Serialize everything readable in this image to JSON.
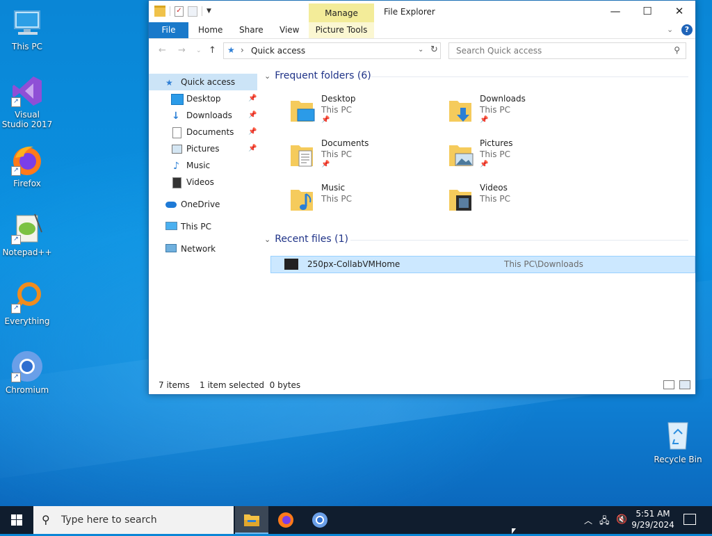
{
  "desktop": {
    "icons": [
      {
        "label": "This PC"
      },
      {
        "label": "Visual Studio 2017"
      },
      {
        "label": "Firefox"
      },
      {
        "label": "Notepad++"
      },
      {
        "label": "Everything"
      },
      {
        "label": "Chromium"
      },
      {
        "label": "Recycle Bin"
      }
    ]
  },
  "window": {
    "title": "File Explorer",
    "contextual_group": "Manage",
    "tabs": [
      "File",
      "Home",
      "Share",
      "View",
      "Picture Tools"
    ],
    "address": "Quick access",
    "search_placeholder": "Search Quick access",
    "help": "?"
  },
  "nav": {
    "items": [
      {
        "label": "Quick access",
        "icon": "star-icon",
        "selected": true
      },
      {
        "label": "Desktop",
        "icon": "desktop-icon",
        "pinned": true
      },
      {
        "label": "Downloads",
        "icon": "download-icon",
        "pinned": true
      },
      {
        "label": "Documents",
        "icon": "document-icon",
        "pinned": true
      },
      {
        "label": "Pictures",
        "icon": "picture-icon",
        "pinned": true
      },
      {
        "label": "Music",
        "icon": "music-icon"
      },
      {
        "label": "Videos",
        "icon": "video-icon"
      },
      {
        "label": "OneDrive",
        "icon": "cloud-icon"
      },
      {
        "label": "This PC",
        "icon": "computer-icon"
      },
      {
        "label": "Network",
        "icon": "network-icon"
      }
    ]
  },
  "content": {
    "frequent_header": "Frequent folders (6)",
    "folders": [
      {
        "name": "Desktop",
        "location": "This PC",
        "pinned": true
      },
      {
        "name": "Downloads",
        "location": "This PC",
        "pinned": true
      },
      {
        "name": "Documents",
        "location": "This PC",
        "pinned": true
      },
      {
        "name": "Pictures",
        "location": "This PC",
        "pinned": true
      },
      {
        "name": "Music",
        "location": "This PC"
      },
      {
        "name": "Videos",
        "location": "This PC"
      }
    ],
    "recent_header": "Recent files (1)",
    "recent": [
      {
        "name": "250px-CollabVMHome",
        "path": "This PC\\Downloads"
      }
    ]
  },
  "status": {
    "items": "7 items",
    "selected": "1 item selected  0 bytes"
  },
  "taskbar": {
    "search_placeholder": "Type here to search",
    "time": "5:51 AM",
    "date": "9/29/2024"
  },
  "colors": {
    "accent": "#1979ca",
    "selection": "#cce4f7",
    "group_header": "#1e3287",
    "taskbar": "#101d2e"
  }
}
